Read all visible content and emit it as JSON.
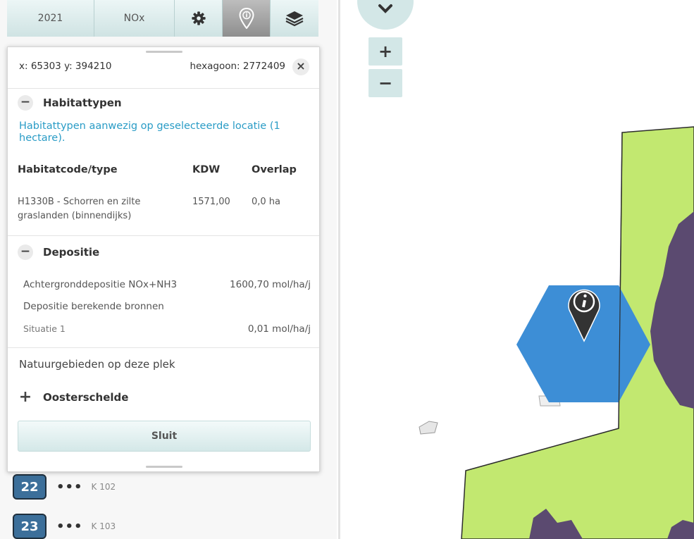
{
  "toolbar": {
    "year": "2021",
    "substance": "NOx",
    "icons": [
      "gear-icon",
      "info-marker-icon",
      "layers-icon"
    ],
    "active": "info-marker-icon"
  },
  "popup": {
    "coords": "x: 65303 y: 394210",
    "hexagon": "hexagoon: 2772409",
    "close_symbol": "×",
    "habitat": {
      "toggle": "−",
      "title": "Habitattypen",
      "description": "Habitattypen aanwezig op geselecteerde locatie (1 hectare).",
      "columns": [
        "Habitatcode/type",
        "KDW",
        "Overlap"
      ],
      "rows": [
        {
          "type": "H1330B - Schorren en zilte graslanden (binnendijks)",
          "kdw": "1571,00",
          "overlap": "0,0 ha"
        }
      ]
    },
    "deposition": {
      "toggle": "−",
      "title": "Depositie",
      "background_label": "Achtergronddepositie NOx+NH3",
      "background_value": "1600,70 mol/ha/j",
      "computed_label": "Depositie berekende bronnen",
      "situation_label": "Situatie 1",
      "situation_value": "0,01 mol/ha/j"
    },
    "nature": {
      "heading": "Natuurgebieden op deze plek",
      "toggle": "+",
      "area": "Oosterschelde"
    },
    "close_button": "Sluit"
  },
  "list": [
    {
      "number": "22",
      "dots": "•••",
      "label": "K 102"
    },
    {
      "number": "23",
      "dots": "•••",
      "label": "K 103"
    }
  ],
  "map": {
    "zoom_in": "+",
    "zoom_out": "−",
    "colors": {
      "land": "#c2e870",
      "habitat": "#5b4a70",
      "hexagon": "#3d8ed6",
      "marker": "#333333"
    }
  }
}
